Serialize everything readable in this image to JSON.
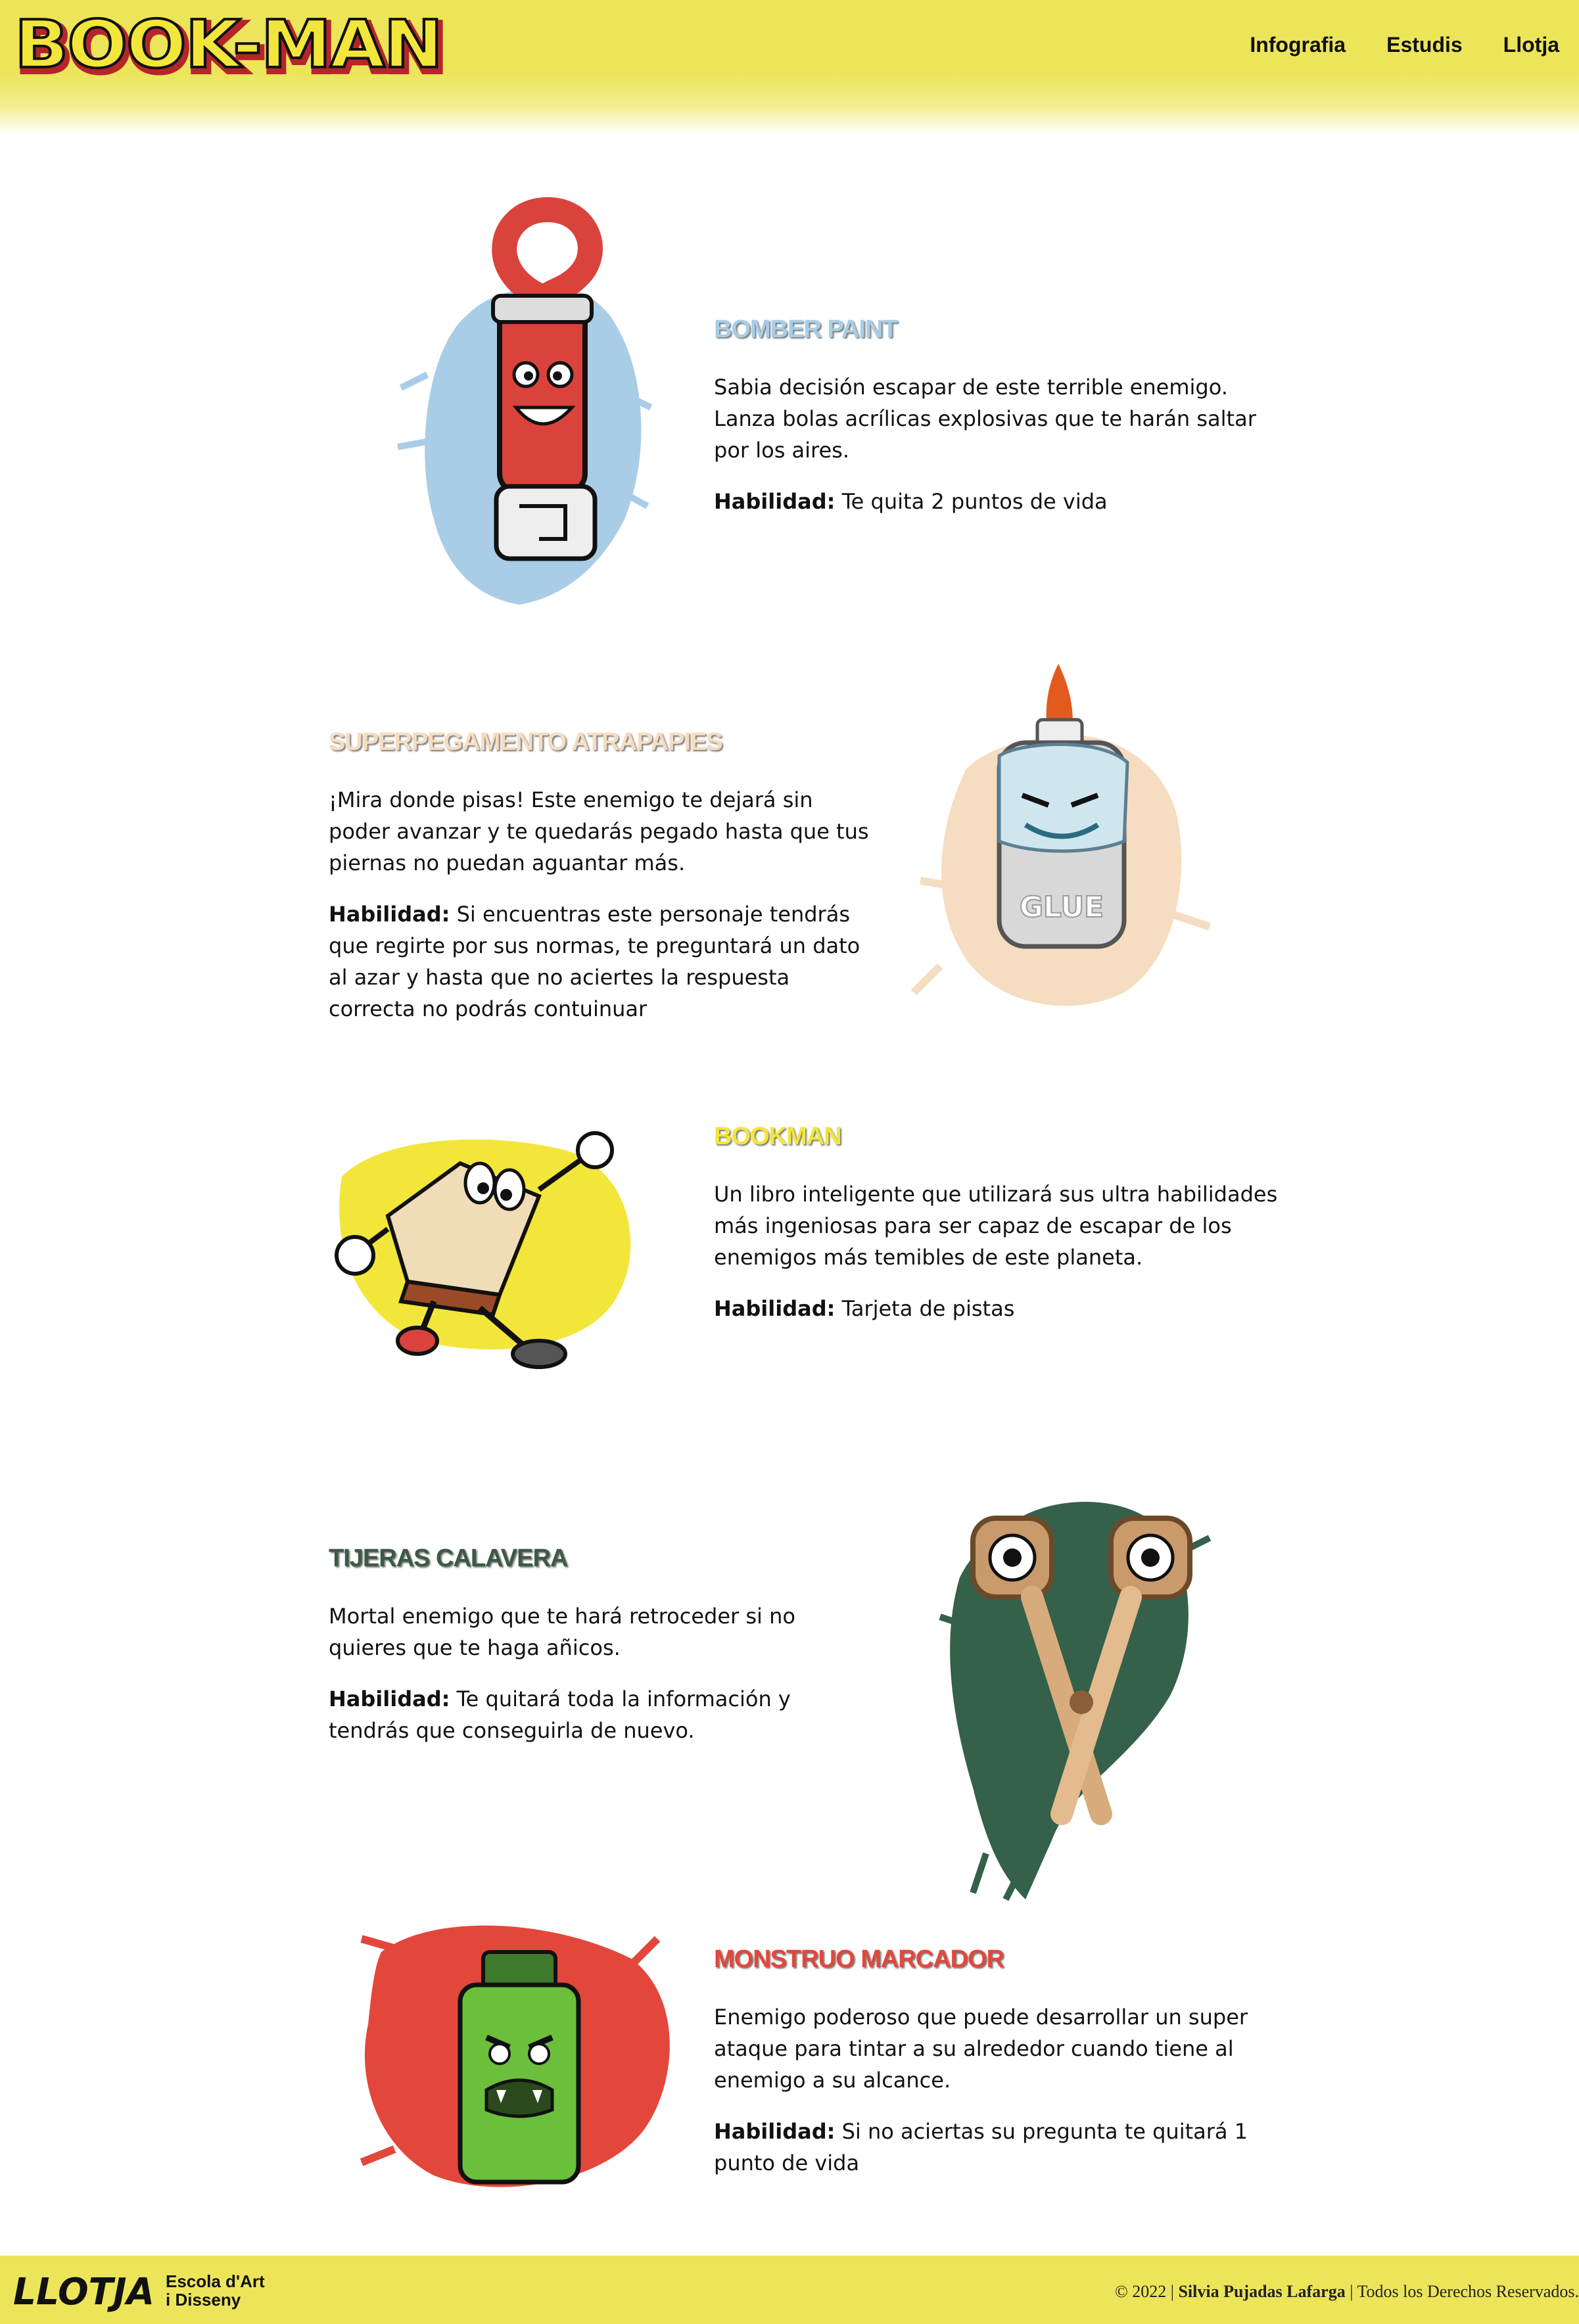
{
  "header": {
    "logo_text": "BOOK-MAN",
    "nav": [
      "Infografia",
      "Estudis",
      "Llotja"
    ]
  },
  "characters": [
    {
      "title": "BOMBER PAINT",
      "title_color": "#a9cde6",
      "description": "Sabia decisión escapar de este terrible enemigo. Lanza bolas acrílicas explosivas que te harán saltar por los aires.",
      "skill_label": "Habilidad:",
      "skill_text": "Te quita 2 puntos de vida",
      "icon": "paint-tube-character"
    },
    {
      "title": "SUPERPEGAMENTO ATRAPAPIES",
      "title_color": "#f6dcc0",
      "description": "¡Mira donde pisas! Este enemigo te dejará sin poder avanzar y te quedarás pegado hasta que tus piernas no puedan aguantar más.",
      "skill_label": "Habilidad:",
      "skill_text": "Si encuentras este personaje tendrás que regirte por sus normas, te preguntará un dato al azar y hasta que no aciertes la respuesta correcta no podrás contuinuar",
      "icon": "glue-bottle-character",
      "bottle_label": "GLUE"
    },
    {
      "title": "BOOKMAN",
      "title_color": "#f3e63a",
      "description": "Un libro inteligente que utilizará sus ultra habilidades más ingeniosas para ser capaz de escapar de los enemigos más temibles de este planeta.",
      "skill_label": "Habilidad:",
      "skill_text": "Tarjeta de pistas",
      "icon": "book-character"
    },
    {
      "title": "TIJERAS CALAVERA",
      "title_color": "#3b5a43",
      "description": "Mortal enemigo que te hará retroceder si no quieres que te haga añicos.",
      "skill_label": "Habilidad:",
      "skill_text": "Te quitará toda la información y tendrás que conseguirla de nuevo.",
      "icon": "scissors-character"
    },
    {
      "title": "MONSTRUO MARCADOR",
      "title_color": "#e3473c",
      "description": "Enemigo poderoso que puede desarrollar un super ataque para tintar a su alrededor cuando tiene al enemigo a su alcance.",
      "skill_label": "Habilidad:",
      "skill_text": "Si no aciertas su pregunta te quitará 1 punto de vida",
      "icon": "marker-monster-character"
    }
  ],
  "footer": {
    "logo_main": "LLOTJA",
    "logo_sub_1": "Escola d'Art",
    "logo_sub_2": "i Disseny",
    "copyright_prefix": "© 2022 |",
    "copyright_author": "Silvia Pujadas Lafarga",
    "copyright_suffix": "| Todos los Derechos Reservados."
  }
}
